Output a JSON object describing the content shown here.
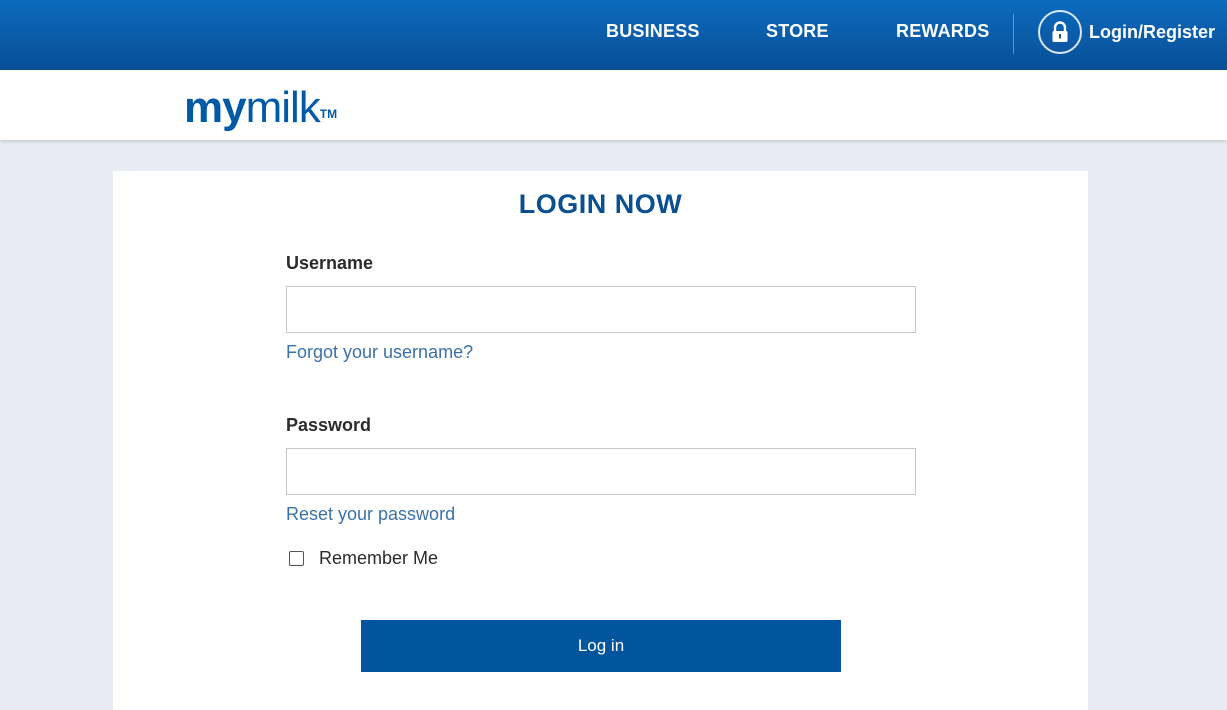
{
  "nav": {
    "business": "BUSINESS",
    "store": "STORE",
    "rewards": "REWARDS",
    "login_register": "Login/Register",
    "login_icon": "lock-icon"
  },
  "brand": {
    "logo_my": "my",
    "logo_milk": "milk",
    "logo_tm": "TM"
  },
  "form": {
    "title": "LOGIN NOW",
    "username_label": "Username",
    "username_value": "",
    "forgot_username": "Forgot your username?",
    "password_label": "Password",
    "password_value": "",
    "reset_password": "Reset your password",
    "remember_me": "Remember Me",
    "remember_checked": false,
    "submit_label": "Log in"
  },
  "colors": {
    "topbar": "#0a5aa6",
    "brand_blue": "#005aa6",
    "title_blue": "#0a4f8f",
    "link_blue": "#3b72a8",
    "button_blue": "#00559e",
    "page_background": "#e8ebf3"
  }
}
